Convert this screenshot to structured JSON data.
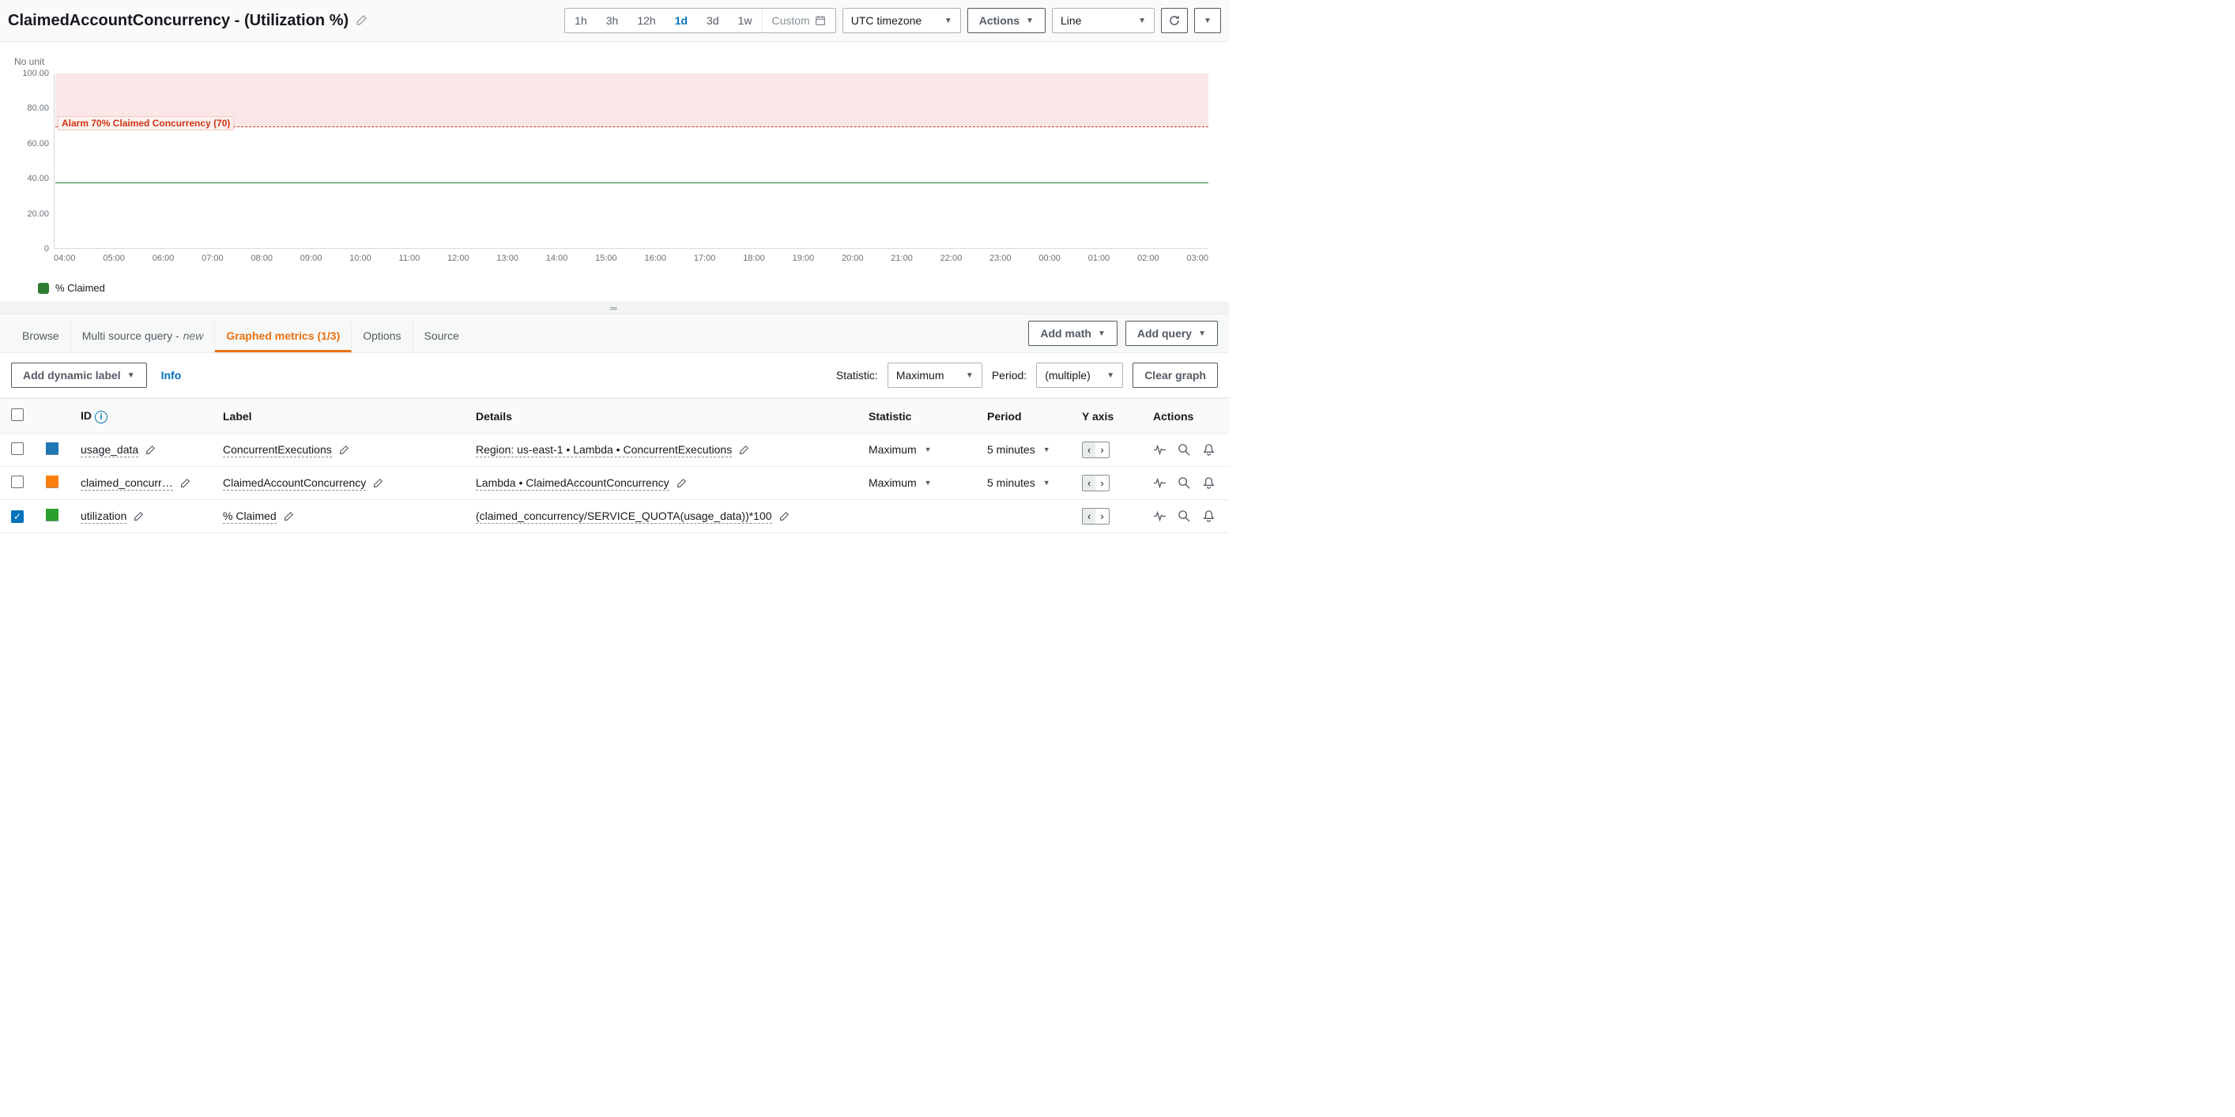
{
  "header": {
    "title": "ClaimedAccountConcurrency - (Utilization %)",
    "time_options": [
      "1h",
      "3h",
      "12h",
      "1d",
      "3d",
      "1w"
    ],
    "time_selected": "1d",
    "custom_label": "Custom",
    "timezone": "UTC timezone",
    "actions_label": "Actions",
    "chart_type": "Line"
  },
  "chart": {
    "y_unit_label": "No unit",
    "y_ticks": [
      "100.00",
      "80.00",
      "60.00",
      "40.00",
      "20.00",
      "0"
    ],
    "x_ticks": [
      "04:00",
      "05:00",
      "06:00",
      "07:00",
      "08:00",
      "09:00",
      "10:00",
      "11:00",
      "12:00",
      "13:00",
      "14:00",
      "15:00",
      "16:00",
      "17:00",
      "18:00",
      "19:00",
      "20:00",
      "21:00",
      "22:00",
      "23:00",
      "00:00",
      "01:00",
      "02:00",
      "03:00"
    ],
    "alarm_label": "Alarm 70% Claimed Concurrency (70)",
    "legend_label": "% Claimed"
  },
  "chart_data": {
    "type": "line",
    "title": "ClaimedAccountConcurrency - (Utilization %)",
    "xlabel": "",
    "ylabel": "No unit",
    "ylim": [
      0,
      100
    ],
    "x": [
      "04:00",
      "05:00",
      "06:00",
      "07:00",
      "08:00",
      "09:00",
      "10:00",
      "11:00",
      "12:00",
      "13:00",
      "14:00",
      "15:00",
      "16:00",
      "17:00",
      "18:00",
      "19:00",
      "20:00",
      "21:00",
      "22:00",
      "23:00",
      "00:00",
      "01:00",
      "02:00",
      "03:00"
    ],
    "series": [
      {
        "name": "% Claimed",
        "color": "#2e7d32",
        "values": [
          38,
          38,
          38,
          38,
          38,
          38,
          38,
          38,
          38,
          38,
          38,
          38,
          38,
          38,
          38,
          38,
          38,
          38,
          38,
          38,
          38,
          38,
          38,
          38
        ]
      }
    ],
    "annotations": [
      {
        "type": "hband",
        "y0": 70,
        "y1": 100,
        "label": "Alarm 70% Claimed Concurrency (70)",
        "color": "#d13212"
      }
    ]
  },
  "tabs": {
    "items": [
      {
        "label": "Browse"
      },
      {
        "label": "Multi source query -",
        "suffix": "new"
      },
      {
        "label": "Graphed metrics (1/3)",
        "active": true
      },
      {
        "label": "Options"
      },
      {
        "label": "Source"
      }
    ],
    "add_math": "Add math",
    "add_query": "Add query"
  },
  "toolbar": {
    "add_dynamic_label": "Add dynamic label",
    "info": "Info",
    "statistic_label": "Statistic:",
    "statistic_value": "Maximum",
    "period_label": "Period:",
    "period_value": "(multiple)",
    "clear_graph": "Clear graph"
  },
  "table": {
    "headers": {
      "id": "ID",
      "label": "Label",
      "details": "Details",
      "statistic": "Statistic",
      "period": "Period",
      "yaxis": "Y axis",
      "actions": "Actions"
    },
    "rows": [
      {
        "checked": false,
        "color": "#1f77b4",
        "id": "usage_data",
        "label": "ConcurrentExecutions",
        "details": "Region: us-east-1 • Lambda • ConcurrentExecutions",
        "statistic": "Maximum",
        "period": "5 minutes",
        "yaxis_left": true
      },
      {
        "checked": false,
        "color": "#ff7f0e",
        "id": "claimed_concurr…",
        "label": "ClaimedAccountConcurrency",
        "details": "Lambda • ClaimedAccountConcurrency",
        "statistic": "Maximum",
        "period": "5 minutes",
        "yaxis_left": true
      },
      {
        "checked": true,
        "color": "#2ca02c",
        "id": "utilization",
        "label": "% Claimed",
        "details": "(claimed_concurrency/SERVICE_QUOTA(usage_data))*100",
        "statistic": "",
        "period": "",
        "yaxis_left": true
      }
    ]
  }
}
